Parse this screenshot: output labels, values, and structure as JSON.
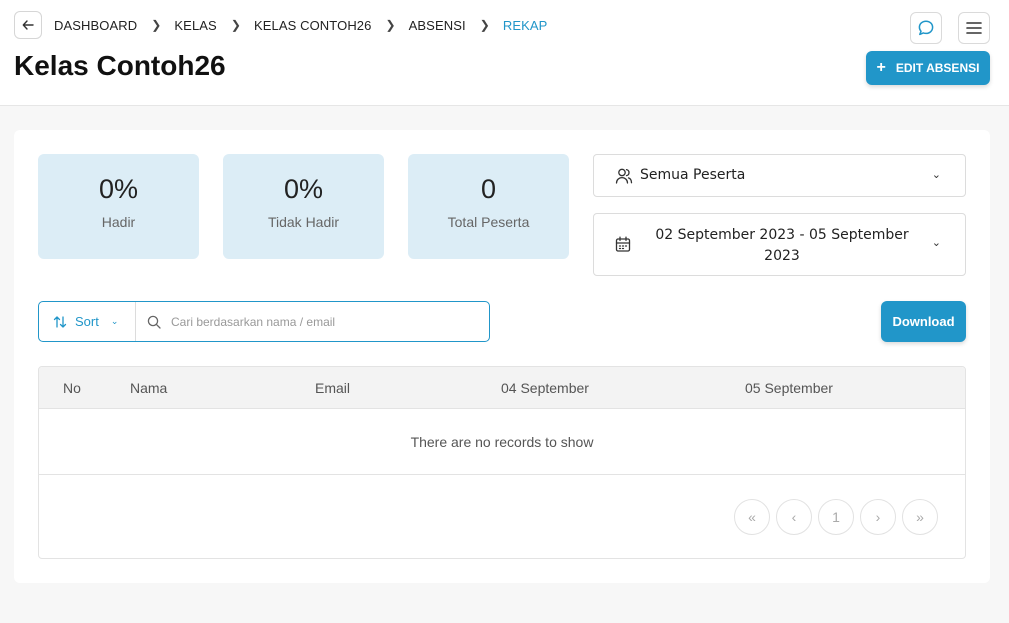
{
  "breadcrumb": [
    "DASHBOARD",
    "KELAS",
    "KELAS CONTOH26",
    "ABSENSI",
    "REKAP"
  ],
  "page_title": "Kelas Contoh26",
  "edit_button": "EDIT ABSENSI",
  "stats": [
    {
      "value": "0%",
      "label": "Hadir"
    },
    {
      "value": "0%",
      "label": "Tidak Hadir"
    },
    {
      "value": "0",
      "label": "Total Peserta"
    }
  ],
  "participant_filter": "Semua Peserta",
  "date_range": "02 September 2023 - 05 September 2023",
  "sort_label": "Sort",
  "search_placeholder": "Cari berdasarkan nama / email",
  "download_button": "Download",
  "table": {
    "columns": [
      "No",
      "Nama",
      "Email",
      "04 September",
      "05 September"
    ],
    "empty_text": "There are no records to show"
  },
  "pagination": {
    "first": "«",
    "prev": "‹",
    "current": "1",
    "next": "›",
    "last": "»"
  },
  "colors": {
    "accent": "#2196c9",
    "stat_bg": "#dcedf6"
  }
}
